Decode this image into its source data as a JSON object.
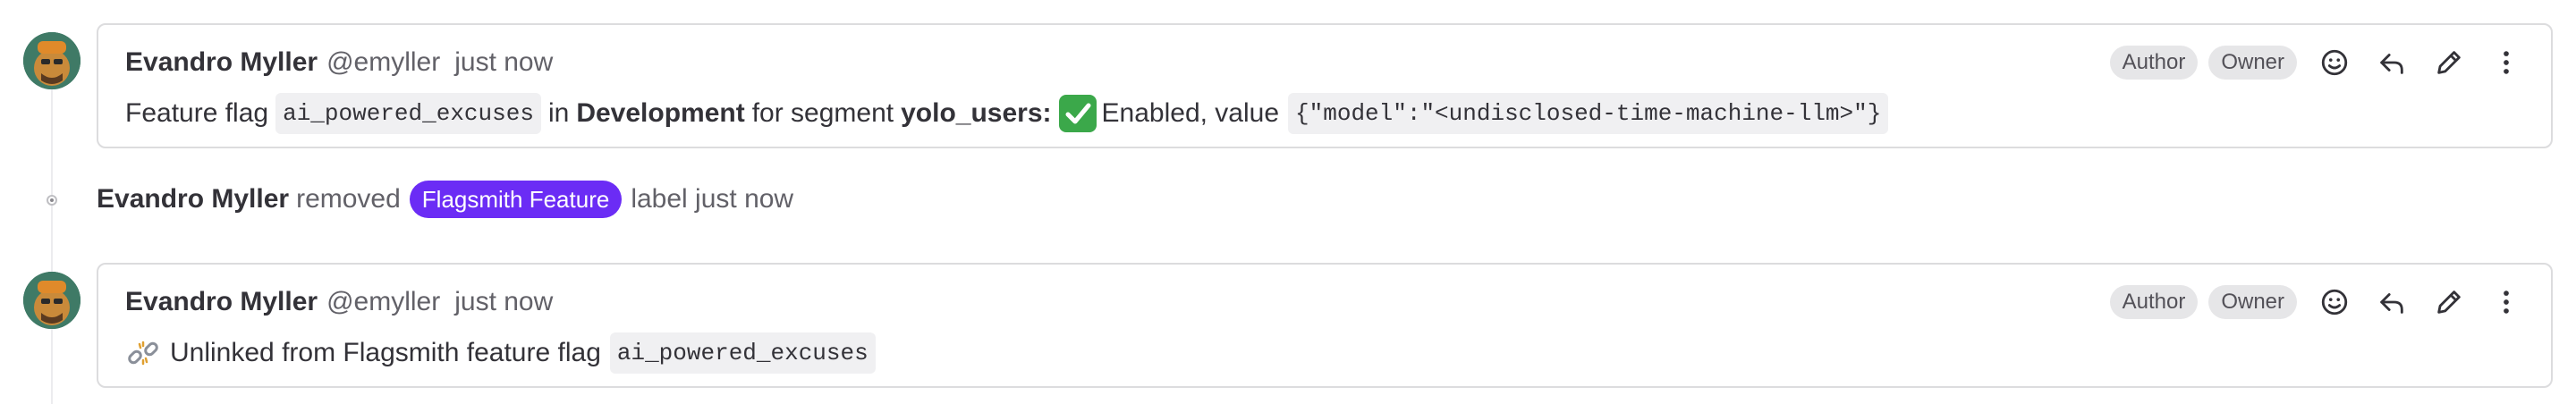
{
  "notes": [
    {
      "author": "Evandro Myller",
      "username": "@emyller",
      "time": "just now",
      "badges": [
        "Author",
        "Owner"
      ],
      "body": {
        "prefix": "Feature flag",
        "flag": "ai_powered_excuses",
        "in": "in",
        "environment": "Development",
        "for_segment": "for segment",
        "segment": "yolo_users:",
        "status_icon": "check-mark-emoji",
        "status": "Enabled, value",
        "value": "{\"model\":\"<undisclosed-time-machine-llm>\"}"
      }
    },
    {
      "author": "Evandro Myller",
      "username": "@emyller",
      "time": "just now",
      "badges": [
        "Author",
        "Owner"
      ],
      "body": {
        "icon": "broken-chain-emoji",
        "text": "Unlinked from Flagsmith feature flag",
        "flag": "ai_powered_excuses"
      }
    }
  ],
  "system_note": {
    "author": "Evandro Myller",
    "action": "removed",
    "label": "Flagsmith Feature",
    "label_color": "#6b2cf5",
    "suffix": "label just now"
  },
  "actions": [
    "emoji-reaction-icon",
    "reply-icon",
    "edit-pencil-icon",
    "more-vertical-icon"
  ]
}
